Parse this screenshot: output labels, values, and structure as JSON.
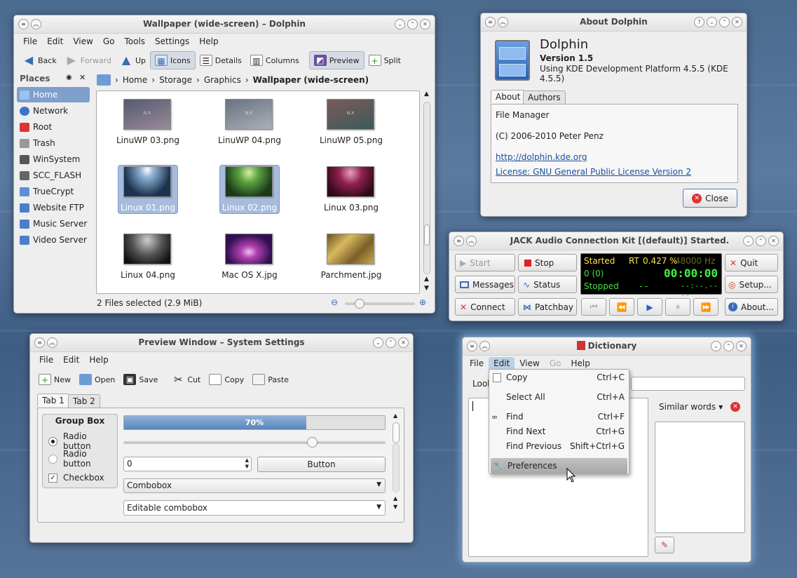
{
  "dolphin": {
    "title": "Wallpaper (wide-screen) – Dolphin",
    "menu": [
      "File",
      "Edit",
      "View",
      "Go",
      "Tools",
      "Settings",
      "Help"
    ],
    "toolbar": {
      "back": "Back",
      "forward": "Forward",
      "up": "Up",
      "icons": "Icons",
      "details": "Details",
      "columns": "Columns",
      "preview": "Preview",
      "split": "Split"
    },
    "places_title": "Places",
    "places": [
      "Home",
      "Network",
      "Root",
      "Trash",
      "WinSystem",
      "SCC_FLASH",
      "TrueCrypt",
      "Website FTP",
      "Music Server",
      "Video Server"
    ],
    "breadcrumb": [
      "Home",
      "Storage",
      "Graphics",
      "Wallpaper (wide-screen)"
    ],
    "files": [
      "LinuWP 03.png",
      "LinuWP 04.png",
      "LinuWP 05.png",
      "Linux 01.png",
      "Linux 02.png",
      "Linux 03.png",
      "Linux 04.png",
      "Mac OS X.jpg",
      "Parchment.jpg"
    ],
    "thumb_text": "N.X",
    "status": "2 Files selected (2.9 MiB)"
  },
  "about": {
    "title": "About Dolphin",
    "app": "Dolphin",
    "version": "Version 1.5",
    "platform": "Using KDE Development Platform 4.5.5 (KDE 4.5.5)",
    "tabs": [
      "About",
      "Authors"
    ],
    "desc": "File Manager",
    "copyright": "(C) 2006-2010 Peter Penz",
    "url": "http://dolphin.kde.org",
    "license": "License: GNU General Public License Version 2",
    "close": "Close"
  },
  "jack": {
    "title": "JACK Audio Connection Kit [(default)] Started.",
    "start": "Start",
    "stop": "Stop",
    "quit": "Quit",
    "messages": "Messages",
    "status": "Status",
    "setup": "Setup...",
    "connect": "Connect",
    "patchbay": "Patchbay",
    "about": "About...",
    "display": {
      "started": "Started",
      "rt": "RT",
      "load": "0.427 %",
      "rate": "48000 Hz",
      "xruns": "0 (0)",
      "time": "00:00:00",
      "state": "Stopped",
      "dash": "--",
      "pos": "--:--.----"
    }
  },
  "settings": {
    "title": "Preview Window – System Settings",
    "menu": [
      "File",
      "Edit",
      "Help"
    ],
    "toolbar": {
      "new": "New",
      "open": "Open",
      "save": "Save",
      "cut": "Cut",
      "copy": "Copy",
      "paste": "Paste"
    },
    "tabs": [
      "Tab 1",
      "Tab 2"
    ],
    "group": "Group Box",
    "radio1": "Radio button",
    "radio2": "Radio button",
    "checkbox": "Checkbox",
    "progress": 0.7,
    "progress_label": "70%",
    "slider": 0.72,
    "spin": "0",
    "button": "Button",
    "combo": "Combobox",
    "edit_combo": "Editable combobox"
  },
  "dict": {
    "title": "Dictionary",
    "menu": [
      "File",
      "Edit",
      "View",
      "Go",
      "Help"
    ],
    "look": "Look",
    "similar": "Similar words",
    "edit_menu": [
      {
        "label": "Copy",
        "shortcut": "Ctrl+C"
      },
      {
        "label": "Select All",
        "shortcut": "Ctrl+A"
      },
      {
        "label": "Find",
        "shortcut": "Ctrl+F"
      },
      {
        "label": "Find Next",
        "shortcut": "Ctrl+G"
      },
      {
        "label": "Find Previous",
        "shortcut": "Shift+Ctrl+G"
      },
      {
        "label": "Preferences",
        "shortcut": ""
      }
    ]
  }
}
